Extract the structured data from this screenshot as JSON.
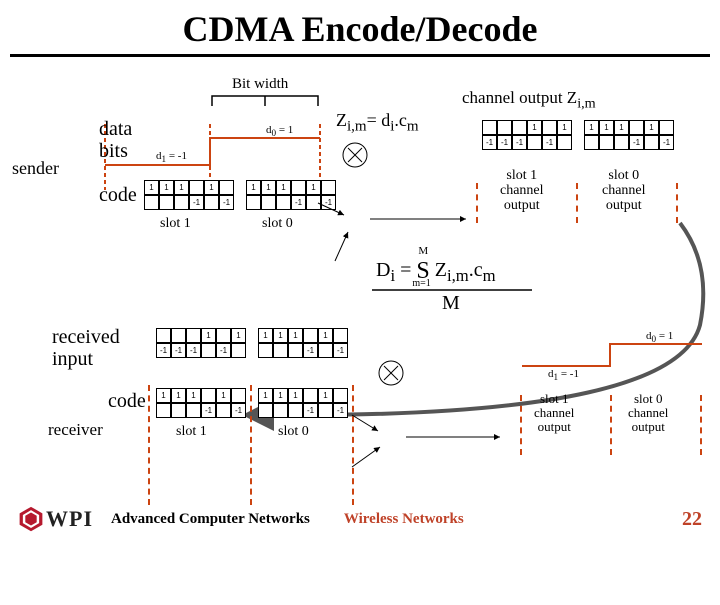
{
  "title": "CDMA Encode/Decode",
  "bitwidth": "Bit width",
  "sender": "sender",
  "databits": "data\nbits",
  "code": "code",
  "d0": "d",
  "d0sub": "0",
  "d0v": " = 1",
  "d1": "d",
  "d1sub": "1",
  "d1v": " = -1",
  "zim": "Z",
  "zim_sub": "i,m",
  "zim_eq": "= d",
  "zim_sub2": "i",
  "zim_dot": ".c",
  "zim_sub3": "m",
  "chanout": "channel output Z",
  "chanout_sub": "i,m",
  "slot1": "slot 1",
  "slot0": "slot 0",
  "s1chan": "slot 1\nchannel\noutput",
  "s0chan": "slot 0\nchannel\noutput",
  "di": "D",
  "di_sub": "i",
  "di_eq": " = ",
  "sigma": "S",
  "m1": "m=1",
  "mM": "M",
  "zc": " Z",
  "zc_sub": "i,m",
  "zc_dot": ".c",
  "zc_sub2": "m",
  "bigM": "M",
  "received": "received\ninput",
  "receiver": "receiver",
  "footer1": "Advanced Computer Networks",
  "footer2": "Wireless Networks",
  "page": "22",
  "chips": {
    "top": [
      "1",
      "1",
      "1",
      "",
      "1",
      ""
    ],
    "bot": [
      "",
      "",
      "",
      "-1",
      "",
      "-1"
    ],
    "t2": [
      "-1",
      "-1",
      "-1",
      "",
      "-1",
      ""
    ],
    "b2": [
      "",
      "",
      "",
      "1",
      "",
      "1"
    ]
  }
}
